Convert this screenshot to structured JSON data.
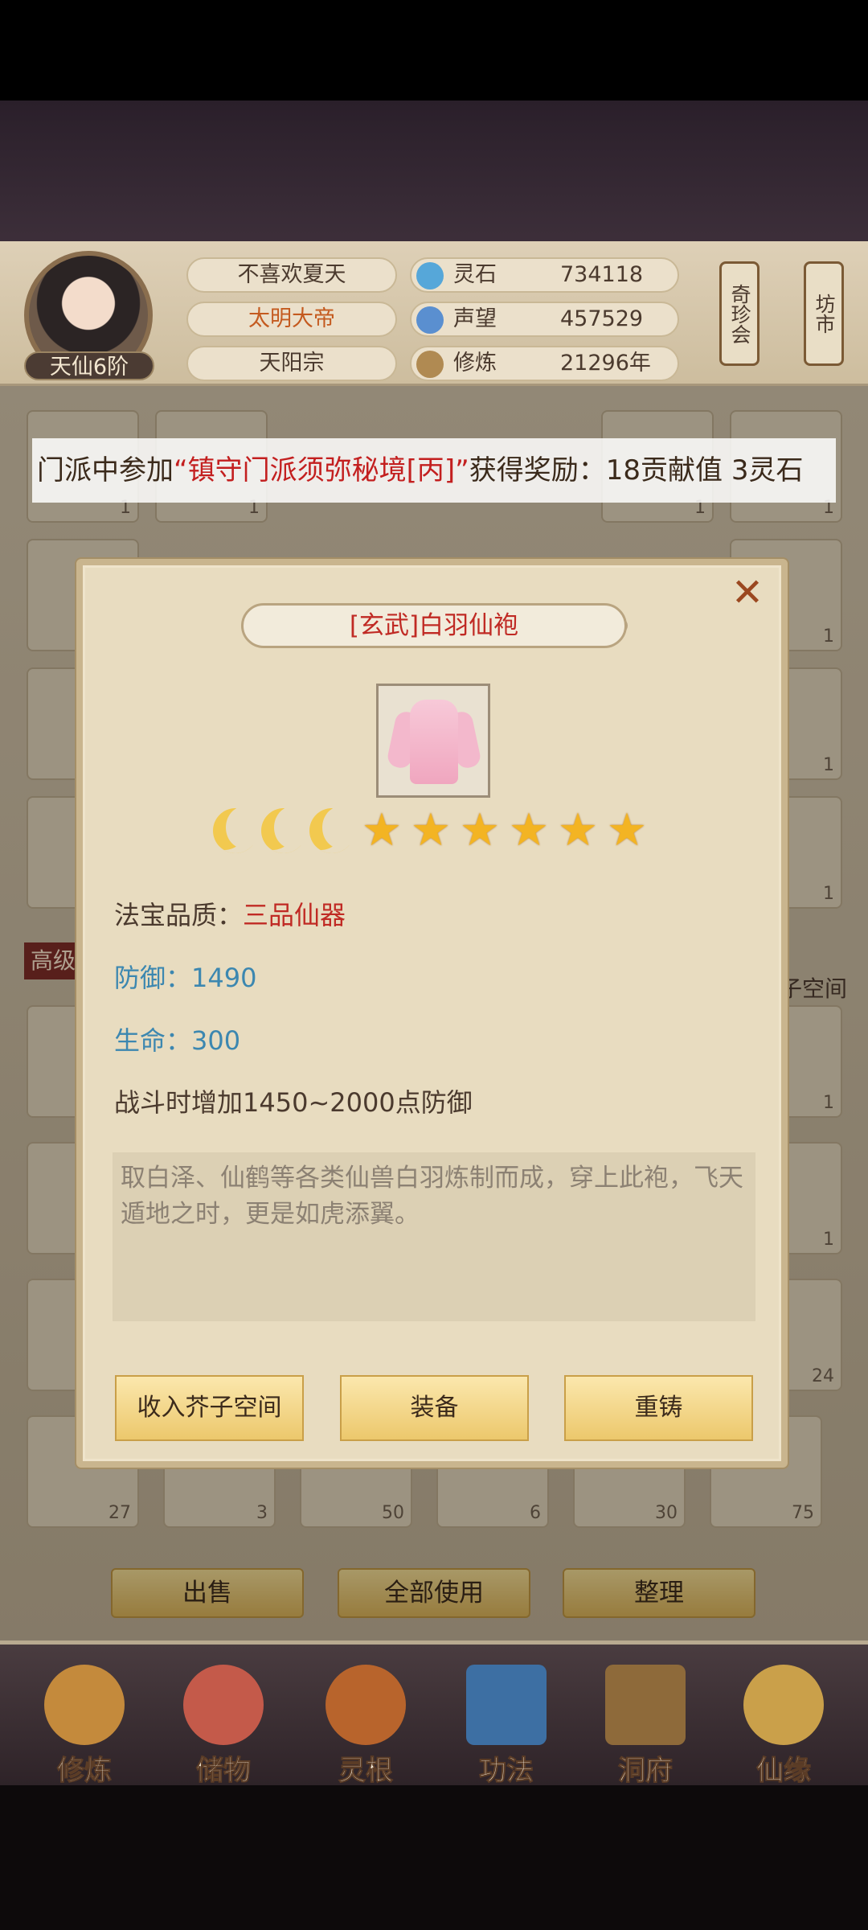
{
  "header": {
    "player_name": "不喜欢夏天",
    "title": "太明大帝",
    "sect": "天阳宗",
    "rank": "天仙6阶",
    "stats": [
      {
        "label": "灵石",
        "value": "734118",
        "icon": "spirit-stone-icon",
        "color": "#56a7d9"
      },
      {
        "label": "声望",
        "value": "457529",
        "icon": "prestige-icon",
        "color": "#5a8fd0"
      },
      {
        "label": "修炼",
        "value": "21296年",
        "icon": "meditation-icon",
        "color": "#b08a52"
      }
    ],
    "side_buttons": [
      "奇珍会",
      "坊市"
    ]
  },
  "banner": {
    "prefix": "门派中参加",
    "highlight": "“镇守门派须弥秘境[丙]”",
    "suffix": "获得奖励：18贡献值 3灵石"
  },
  "background": {
    "section_label": "高级",
    "right_label": "子空间",
    "slot_counts": [
      "1",
      "1",
      "1",
      "1",
      "1",
      "1",
      "1",
      "1",
      "1",
      "1",
      "1",
      "24",
      "27",
      "3",
      "50",
      "6",
      "30",
      "75"
    ],
    "actions": [
      "出售",
      "全部使用",
      "整理"
    ]
  },
  "item": {
    "name": "[玄武]白羽仙袍",
    "moons": 3,
    "stars": 6,
    "quality_label": "法宝品质：",
    "quality_value": "三品仙器",
    "defense_label": "防御：",
    "defense_value": "1490",
    "life_label": "生命：",
    "life_value": "300",
    "effect": "战斗时增加1450~2000点防御",
    "description": "取白泽、仙鹤等各类仙兽白羽炼制而成，穿上此袍，飞天遁地之时，更是如虎添翼。"
  },
  "modal_buttons": [
    "收入芥子空间",
    "装备",
    "重铸"
  ],
  "nav": [
    {
      "label": "修炼",
      "icon": "cultivation-icon",
      "color": "#c48a3c"
    },
    {
      "label": "储物",
      "icon": "storage-bag-icon",
      "color": "#c45a4a"
    },
    {
      "label": "灵根",
      "icon": "spirit-root-icon",
      "color": "#b8642c"
    },
    {
      "label": "功法",
      "icon": "technique-book-icon",
      "color": "#3d6fa3"
    },
    {
      "label": "洞府",
      "icon": "cave-abode-icon",
      "color": "#8e6a3a"
    },
    {
      "label": "仙缘",
      "icon": "immortal-fate-icon",
      "color": "#caa04a"
    }
  ]
}
